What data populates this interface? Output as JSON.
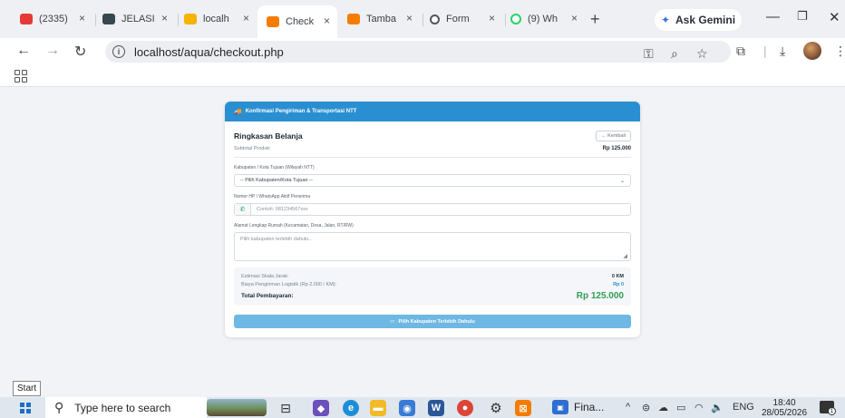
{
  "browser": {
    "tabs": [
      {
        "title": "(2335)",
        "icon": "youtube-icon",
        "color": "#e53935",
        "active": false
      },
      {
        "title": "JELASI",
        "icon": "page-icon",
        "color": "#37474f",
        "active": false
      },
      {
        "title": "localh",
        "icon": "xampp-icon",
        "color": "#f4b400",
        "active": false
      },
      {
        "title": "Check",
        "icon": "xampp-icon",
        "color": "#f57c00",
        "active": true
      },
      {
        "title": "Tamba",
        "icon": "xampp-icon",
        "color": "#f57c00",
        "active": false
      },
      {
        "title": "Form",
        "icon": "gear-icon",
        "color": "#555555",
        "active": false
      },
      {
        "title": "(9) Wh",
        "icon": "whatsapp-icon",
        "color": "#25d366",
        "active": false
      }
    ],
    "tab_close": "×",
    "new_tab": "+",
    "gemini_label": "Ask Gemini",
    "url": "localhost/aqua/checkout.php"
  },
  "checkout": {
    "header": "Konfirmasi Pengiriman & Transportasi NTT",
    "summary_title": "Ringkasan Belanja",
    "back_button": "← Kembali",
    "subtotal_label": "Subtotal Produk:",
    "subtotal_value": "Rp 125.000",
    "city_label": "Kabupaten / Kota Tujuan (Wilayah NTT)",
    "city_selected": "-- Pilih Kabupaten/Kota Tujuan --",
    "phone_label": "Nomor HP / WhatsApp Aktif Penerima",
    "phone_placeholder": "Contoh: 081234567xxx",
    "address_label": "Alamat Lengkap Rumah (Kecamatan, Desa, Jalan, RT/RW)",
    "address_placeholder": "Pilih kabupaten terlebih dahulu...",
    "distance_label": "Estimasi Skala Jarak:",
    "distance_value": "0 KM",
    "shipping_label": "Biaya Pengiriman Logistik (Rp 2.000 / KM):",
    "shipping_value": "Rp 0",
    "total_label": "Total Pembayaran:",
    "total_value": "Rp 125.000",
    "submit_label": "Pilih Kabupaten Terlebih Dahulu",
    "colors": {
      "header": "#2a8fd1",
      "total": "#2e9d52",
      "submit": "#6fb8e3"
    }
  },
  "tooltip": {
    "start": "Start"
  },
  "taskbar": {
    "search_placeholder": "Type here to search",
    "running_app": "Fina...",
    "language": "ENG",
    "time": "18:40",
    "date": "28/05/2026",
    "notification_count": "1"
  }
}
